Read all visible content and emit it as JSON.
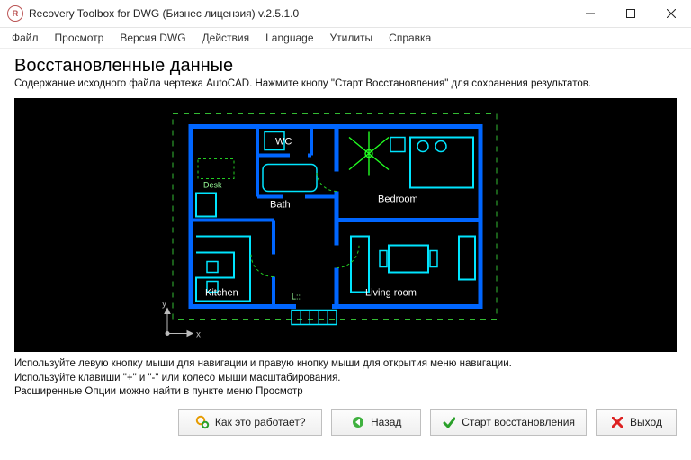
{
  "window": {
    "title": "Recovery Toolbox for DWG (Бизнес лицензия) v.2.5.1.0"
  },
  "menu": {
    "items": [
      "Файл",
      "Просмотр",
      "Версия DWG",
      "Действия",
      "Language",
      "Утилиты",
      "Справка"
    ]
  },
  "header": {
    "title": "Восстановленные данные",
    "subtitle": "Содержание исходного файла чертежа AutoCAD. Нажмите кнопу \"Старт Восстановления\" для сохранения результатов."
  },
  "drawing": {
    "rooms": {
      "wc": "WC",
      "bath": "Bath",
      "bedroom": "Bedroom",
      "kitchen": "Kitchen",
      "living": "Living room"
    },
    "axes": {
      "x": "x",
      "y": "y"
    },
    "misc": {
      "desk": "Desk",
      "lshape": "L::"
    }
  },
  "hints": {
    "l1": "Используйте левую кнопку мыши для навигации и правую кнопку мыши для открытия меню навигации.",
    "l2": "Используйте клавиши \"+\" и \"-\" или колесо мыши масштабирования.",
    "l3": "Расширенные Опции можно найти в пункте меню Просмотр"
  },
  "buttons": {
    "how": "Как это работает?",
    "back": "Назад",
    "start": "Старт восстановления",
    "exit": "Выход"
  }
}
